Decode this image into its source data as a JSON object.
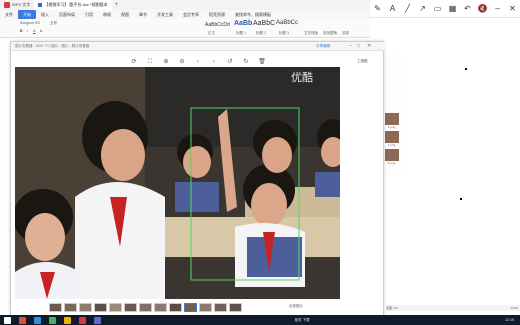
{
  "tabs": [
    {
      "label": "WPS 文字",
      "active": false
    },
    {
      "label": "【视频学习】 酷平台.doc *视图版本",
      "active": true
    }
  ],
  "new_tab_label": "+",
  "menu": {
    "items": [
      "文件",
      "开始",
      "插入",
      "页面布局",
      "引用",
      "审阅",
      "视图",
      "章节",
      "开发工具",
      "会员专享",
      "稻壳资源",
      "查找命令、搜索模板"
    ],
    "selected_index": 1
  },
  "ribbon": {
    "font_name": "Songsun GS",
    "font_size": "五号",
    "style_samples": [
      "AaBbCcDd",
      "AaBb",
      "AaBbC",
      "AaBbCc",
      "AaBbC"
    ],
    "style_labels": [
      "正文",
      "标题 1",
      "标题 2",
      "标题 3"
    ],
    "text_tools": [
      "文字排版",
      "查找替换",
      "选择"
    ]
  },
  "viewer": {
    "title": "图片查看器 - 2020 个人图片 - 图片 - 照片查看器",
    "toolbar_icons": [
      "rotate-icon",
      "fullscreen-icon",
      "zoom-in-icon",
      "zoom-out-icon",
      "prev-icon",
      "next-icon",
      "rotate-left-icon",
      "rotate-right-icon",
      "delete-icon"
    ],
    "watermark": "优酷",
    "right_tools": [
      "分享编辑",
      "工具箱"
    ],
    "filmstrip_count": 13,
    "filmstrip_selected": 9,
    "bottom_label": "全部图片"
  },
  "sidepanel": {
    "items": [
      "3.png",
      "4.png",
      "5.png",
      "6.png"
    ]
  },
  "status": {
    "left": "页面: 1/1",
    "zoom": "170%",
    "right": "相关 下载"
  },
  "taskbar": {
    "time": "22:15"
  },
  "colors": {
    "accent": "#3b7be3",
    "wps_red": "#d83b3b",
    "taskbar": "#0f1a2a",
    "face_box": "#4cd964"
  }
}
